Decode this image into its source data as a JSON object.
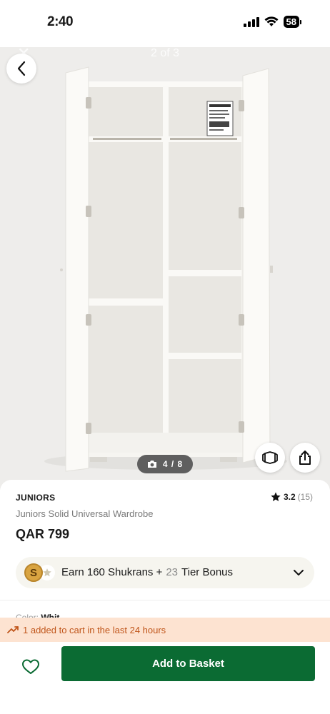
{
  "status_bar": {
    "time": "2:40",
    "battery": "58"
  },
  "gallery": {
    "image_counter": "2 of 3",
    "photo_count": "4 / 8",
    "icons": {
      "back": "chevron-left-icon",
      "view_3d": "3d-view-icon",
      "share": "share-icon",
      "camera": "camera-icon"
    }
  },
  "product": {
    "brand": "JUNIORS",
    "name": "Juniors Solid Universal Wardrobe",
    "price": "QAR 799",
    "rating": "3.2",
    "rating_count": "(15)"
  },
  "shukrans": {
    "coin_letter": "S",
    "earn_text": "Earn 160 Shukrans +",
    "tier_points": "23",
    "tier_label": "Tier Bonus"
  },
  "color": {
    "label": "Color:",
    "value": "Whit"
  },
  "cart_banner": {
    "text": "1 added to cart in the last 24 hours"
  },
  "actions": {
    "add_to_basket": "Add to Basket"
  },
  "colors": {
    "primary_green": "#0b6b33",
    "banner_bg": "#fde3d1",
    "banner_text": "#c0561b"
  }
}
